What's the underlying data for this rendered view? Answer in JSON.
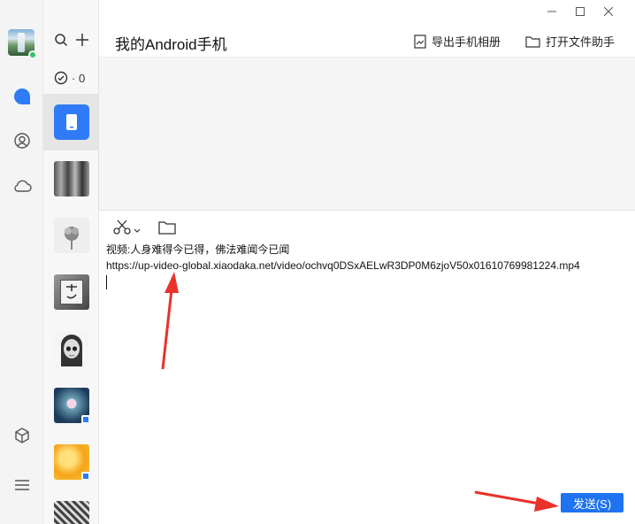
{
  "window": {
    "title": "我的Android手机"
  },
  "header_actions": {
    "export_album": "导出手机相册",
    "open_assistant": "打开文件助手"
  },
  "contact_list": {
    "done_count": "· 0"
  },
  "editor": {
    "line1": "视频:人身难得今已得，佛法难闻今已闻",
    "line2": "https://up-video-global.xiaodaka.net/video/ochvq0DSxAELwR3DP0M6zjoV50x01610769981224.mp4"
  },
  "send_button": {
    "label": "发送(S)"
  },
  "colors": {
    "accent": "#1f73f0",
    "online": "#2cc36b",
    "annotation_arrow": "#e8322a"
  },
  "icons": {
    "nav": [
      "chat-icon",
      "contacts-icon",
      "cloud-icon",
      "cube-icon",
      "menu-icon"
    ],
    "list": [
      "search-icon",
      "add-icon",
      "check-circle-icon",
      "phone-icon"
    ],
    "editor_tools": [
      "scissors-icon",
      "chevron-down-icon",
      "folder-icon"
    ],
    "window": [
      "minimize-icon",
      "maximize-icon",
      "close-icon"
    ]
  }
}
